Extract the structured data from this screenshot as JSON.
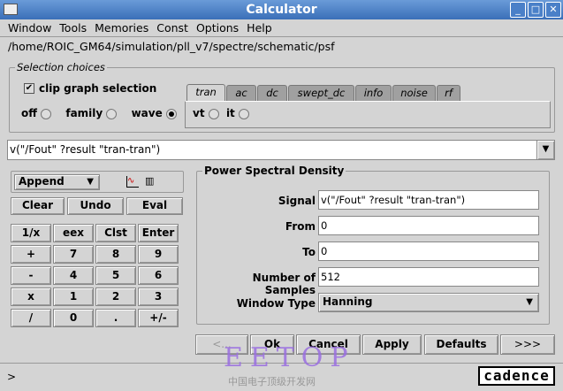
{
  "window": {
    "title": "Calculator"
  },
  "menu": [
    "Window",
    "Tools",
    "Memories",
    "Const",
    "Options",
    "Help"
  ],
  "path": "/home/ROIC_GM64/simulation/pll_v7/spectre/schematic/psf",
  "selection": {
    "legend": "Selection choices",
    "clip_label": "clip graph selection",
    "clip_checked": true,
    "modes": [
      {
        "label": "off",
        "selected": false
      },
      {
        "label": "family",
        "selected": false
      },
      {
        "label": "wave",
        "selected": true
      }
    ],
    "tabs": [
      {
        "label": "tran",
        "active": true
      },
      {
        "label": "ac"
      },
      {
        "label": "dc"
      },
      {
        "label": "swept_dc"
      },
      {
        "label": "info"
      },
      {
        "label": "noise"
      },
      {
        "label": "rf"
      }
    ],
    "tran_options": [
      "vt",
      "it"
    ]
  },
  "expression": "v(\"/Fout\" ?result \"tran-tran\")",
  "keypad": {
    "mode": "Append",
    "actions": [
      "Clear",
      "Undo",
      "Eval"
    ],
    "keys": [
      [
        "1/x",
        "eex",
        "Clst",
        "Enter"
      ],
      [
        "+",
        "7",
        "8",
        "9"
      ],
      [
        "-",
        "4",
        "5",
        "6"
      ],
      [
        "x",
        "1",
        "2",
        "3"
      ],
      [
        "/",
        "0",
        ".",
        "+/-"
      ]
    ]
  },
  "psd": {
    "legend": "Power Spectral Density",
    "fields": [
      {
        "label": "Signal",
        "value": "v(\"/Fout\" ?result \"tran-tran\")"
      },
      {
        "label": "From",
        "value": "0"
      },
      {
        "label": "To",
        "value": "0"
      },
      {
        "label": "Number of Samples",
        "value": "512"
      }
    ],
    "window_type_label": "Window Type",
    "window_type": "Hanning"
  },
  "buttons": {
    "back": "<...",
    "ok": "Ok",
    "cancel": "Cancel",
    "apply": "Apply",
    "defaults": "Defaults",
    "more": ">>>"
  },
  "status": {
    "prompt": ">",
    "logo": "cadence"
  },
  "watermark": {
    "text": "EETOP",
    "sub": "中国电子顶级开发网"
  }
}
